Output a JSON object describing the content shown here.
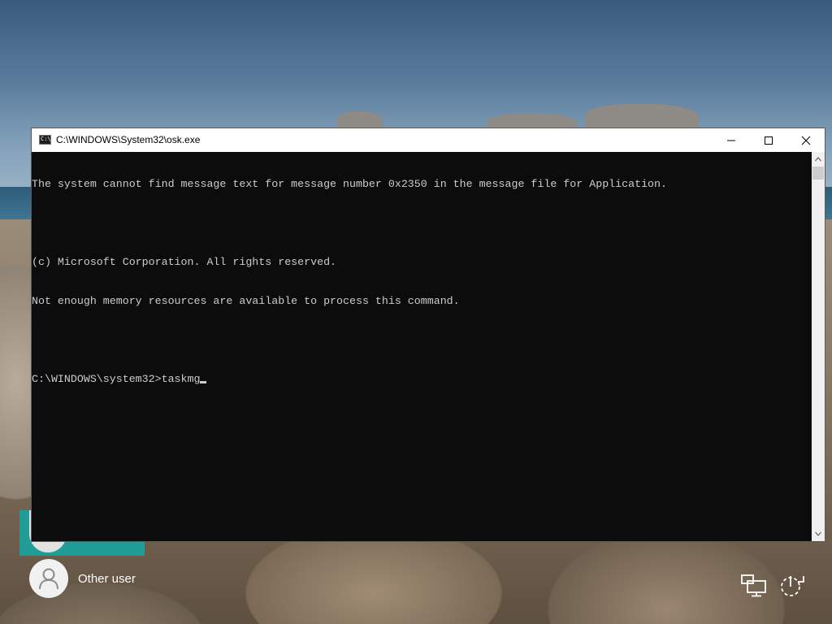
{
  "window": {
    "title": "C:\\WINDOWS\\System32\\osk.exe",
    "minimize_icon": "minimize-icon",
    "maximize_icon": "maximize-icon",
    "close_icon": "close-icon"
  },
  "console": {
    "lines": [
      "The system cannot find message text for message number 0x2350 in the message file for Application.",
      "",
      "(c) Microsoft Corporation. All rights reserved.",
      "Not enough memory resources are available to process this command.",
      "",
      "C:\\WINDOWS\\system32>taskmg"
    ]
  },
  "lock_screen": {
    "other_user_label": "Other user",
    "network_icon": "network-icon",
    "accessibility_icon": "ease-of-access-icon"
  },
  "colors": {
    "console_bg": "#0c0c0c",
    "console_text": "#cccccc",
    "user_tile_accent": "#1aa3a0"
  }
}
